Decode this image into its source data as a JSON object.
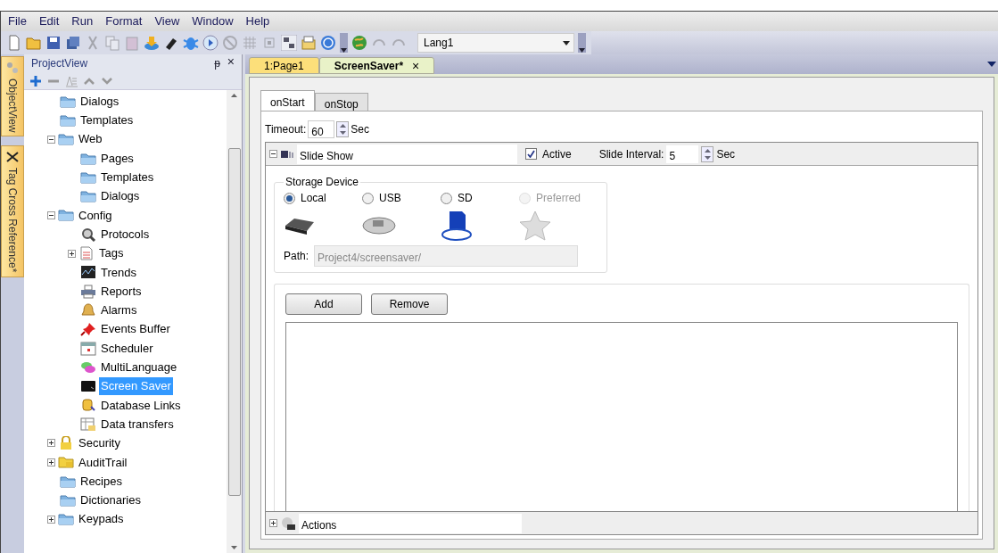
{
  "menu": [
    "File",
    "Edit",
    "Run",
    "Format",
    "View",
    "Window",
    "Help"
  ],
  "toolbar": {
    "language": "Lang1"
  },
  "side_tabs": [
    {
      "label": "ObjectView",
      "kind": "object"
    },
    {
      "label": "Tag Cross Reference*",
      "kind": "cross"
    }
  ],
  "project_view": {
    "title": "ProjectView",
    "pin": "ᵽ",
    "close": "×",
    "tree": [
      {
        "label": "Dialogs",
        "kind": "folder",
        "selected": false
      },
      {
        "label": "Templates",
        "kind": "folder",
        "selected": false
      },
      {
        "label": "Web",
        "kind": "folder",
        "selected": false,
        "expanded": true,
        "children": [
          {
            "label": "Pages",
            "kind": "folder",
            "selected": false
          },
          {
            "label": "Templates",
            "kind": "folder",
            "selected": false
          },
          {
            "label": "Dialogs",
            "kind": "folder",
            "selected": false
          }
        ]
      },
      {
        "label": "Config",
        "kind": "folder",
        "selected": false,
        "expanded": true,
        "children": [
          {
            "label": "Protocols",
            "kind": "protocols",
            "selected": false
          },
          {
            "label": "Tags",
            "kind": "tags",
            "selected": false,
            "expanded": false
          },
          {
            "label": "Trends",
            "kind": "trends",
            "selected": false
          },
          {
            "label": "Reports",
            "kind": "reports",
            "selected": false
          },
          {
            "label": "Alarms",
            "kind": "alarms",
            "selected": false
          },
          {
            "label": "Events Buffer",
            "kind": "events",
            "selected": false
          },
          {
            "label": "Scheduler",
            "kind": "scheduler",
            "selected": false
          },
          {
            "label": "MultiLanguage",
            "kind": "language",
            "selected": false
          },
          {
            "label": "Screen Saver",
            "kind": "screensaver",
            "selected": true
          },
          {
            "label": "Database Links",
            "kind": "database",
            "selected": false
          },
          {
            "label": "Data transfers",
            "kind": "transfers",
            "selected": false
          }
        ]
      },
      {
        "label": "Security",
        "kind": "lock",
        "selected": false,
        "expanded": false
      },
      {
        "label": "AuditTrail",
        "kind": "audit",
        "selected": false,
        "expanded": false
      },
      {
        "label": "Recipes",
        "kind": "folder",
        "selected": false
      },
      {
        "label": "Dictionaries",
        "kind": "folder",
        "selected": false
      },
      {
        "label": "Keypads",
        "kind": "folder",
        "selected": false,
        "expanded": false
      }
    ]
  },
  "doc_tabs": [
    {
      "label": "1:Page1",
      "selected": false
    },
    {
      "label": "ScreenSaver*",
      "selected": true,
      "close": "×"
    }
  ],
  "event_tabs": [
    {
      "label": "onStart",
      "selected": true
    },
    {
      "label": "onStop",
      "selected": false
    }
  ],
  "timeout": {
    "label": "Timeout:",
    "value": "60",
    "unit": "Sec"
  },
  "slide_show": {
    "expanded": true,
    "name": "Slide Show",
    "active": {
      "label": "Active",
      "checked": true
    },
    "interval_label": "Slide Interval:",
    "interval": "5",
    "unit": "Sec",
    "storage": {
      "title": "Storage Device",
      "options": [
        {
          "label": "Local",
          "kind": "local",
          "selected": true,
          "disabled": false
        },
        {
          "label": "USB",
          "kind": "usb",
          "selected": false,
          "disabled": false
        },
        {
          "label": "SD",
          "kind": "sd",
          "selected": false,
          "disabled": false
        },
        {
          "label": "Preferred",
          "kind": "star",
          "selected": false,
          "disabled": true
        }
      ],
      "path_label": "Path:",
      "path": "Project4/screensaver/"
    },
    "buttons": [
      "Add",
      "Remove"
    ]
  },
  "actions": {
    "expanded": false,
    "name": "Actions"
  }
}
